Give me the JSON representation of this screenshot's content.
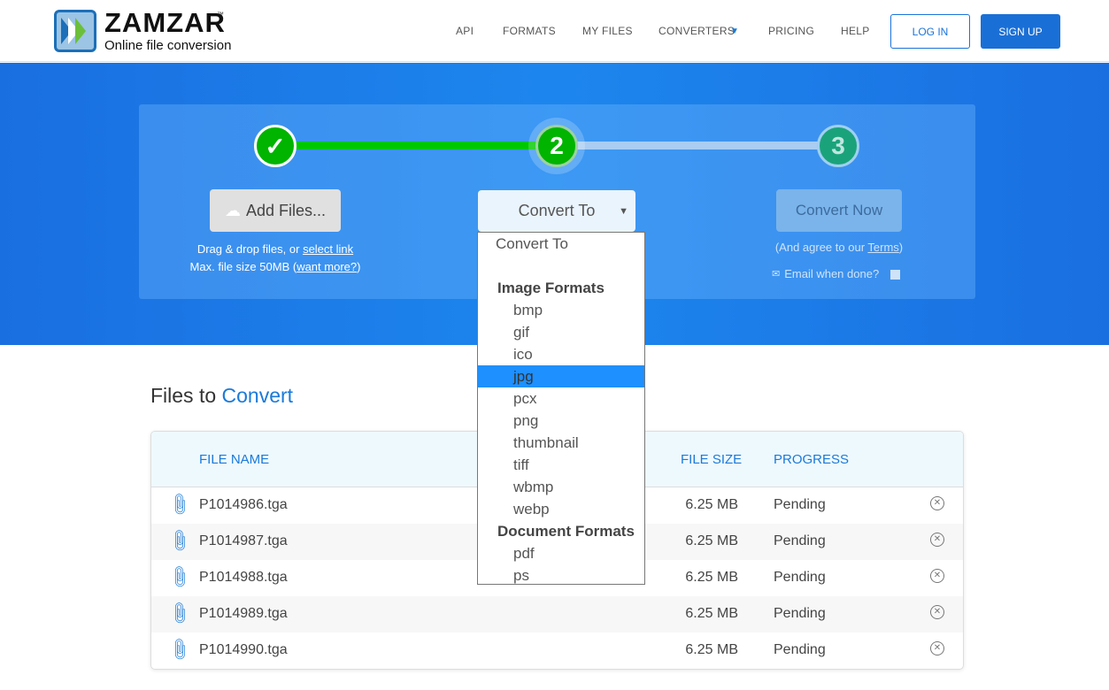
{
  "header": {
    "logo": "ZAMZAR",
    "tm": "™",
    "tagline": "Online file conversion",
    "nav": [
      "API",
      "FORMATS",
      "MY FILES",
      "CONVERTERS",
      "PRICING",
      "HELP"
    ],
    "login": "LOG IN",
    "signup": "SIGN UP"
  },
  "steps": {
    "step1": "✓",
    "step2": "2",
    "step3": "3",
    "add_files": "Add Files...",
    "drag_text": "Drag & drop files, or ",
    "select_link": "select link",
    "max_text": "Max. file size 50MB (",
    "want_more": "want more?",
    "max_close": ")",
    "convert_to": "Convert To",
    "convert_now": "Convert Now",
    "agree_text": "(And agree to our ",
    "terms": "Terms",
    "agree_close": ")",
    "email": "Email when done?"
  },
  "dropdown": {
    "items": [
      {
        "t": "plain",
        "label": "Convert To"
      },
      {
        "t": "plain",
        "label": ""
      },
      {
        "t": "grp",
        "label": "Image Formats"
      },
      {
        "t": "opt",
        "label": "bmp"
      },
      {
        "t": "opt",
        "label": "gif"
      },
      {
        "t": "opt",
        "label": "ico"
      },
      {
        "t": "hl",
        "label": "jpg"
      },
      {
        "t": "opt",
        "label": "pcx"
      },
      {
        "t": "opt",
        "label": "png"
      },
      {
        "t": "opt",
        "label": "thumbnail"
      },
      {
        "t": "opt",
        "label": "tiff"
      },
      {
        "t": "opt",
        "label": "wbmp"
      },
      {
        "t": "opt",
        "label": "webp"
      },
      {
        "t": "grp",
        "label": "Document Formats"
      },
      {
        "t": "opt",
        "label": "pdf"
      },
      {
        "t": "opt",
        "label": "ps"
      }
    ],
    "selected": "jpg"
  },
  "files": {
    "title_a": "Files to ",
    "title_b": "Convert",
    "columns": [
      "FILE NAME",
      "FILE SIZE",
      "PROGRESS"
    ],
    "rows": [
      {
        "name": "P1014986.tga",
        "size": "6.25 MB",
        "progress": "Pending"
      },
      {
        "name": "P1014987.tga",
        "size": "6.25 MB",
        "progress": "Pending"
      },
      {
        "name": "P1014988.tga",
        "size": "6.25 MB",
        "progress": "Pending"
      },
      {
        "name": "P1014989.tga",
        "size": "6.25 MB",
        "progress": "Pending"
      },
      {
        "name": "P1014990.tga",
        "size": "6.25 MB",
        "progress": "Pending"
      }
    ]
  },
  "colors": {
    "accent": "#1a7ad9",
    "step_green": "#00b400",
    "band_blue": "#1a7ae8"
  }
}
